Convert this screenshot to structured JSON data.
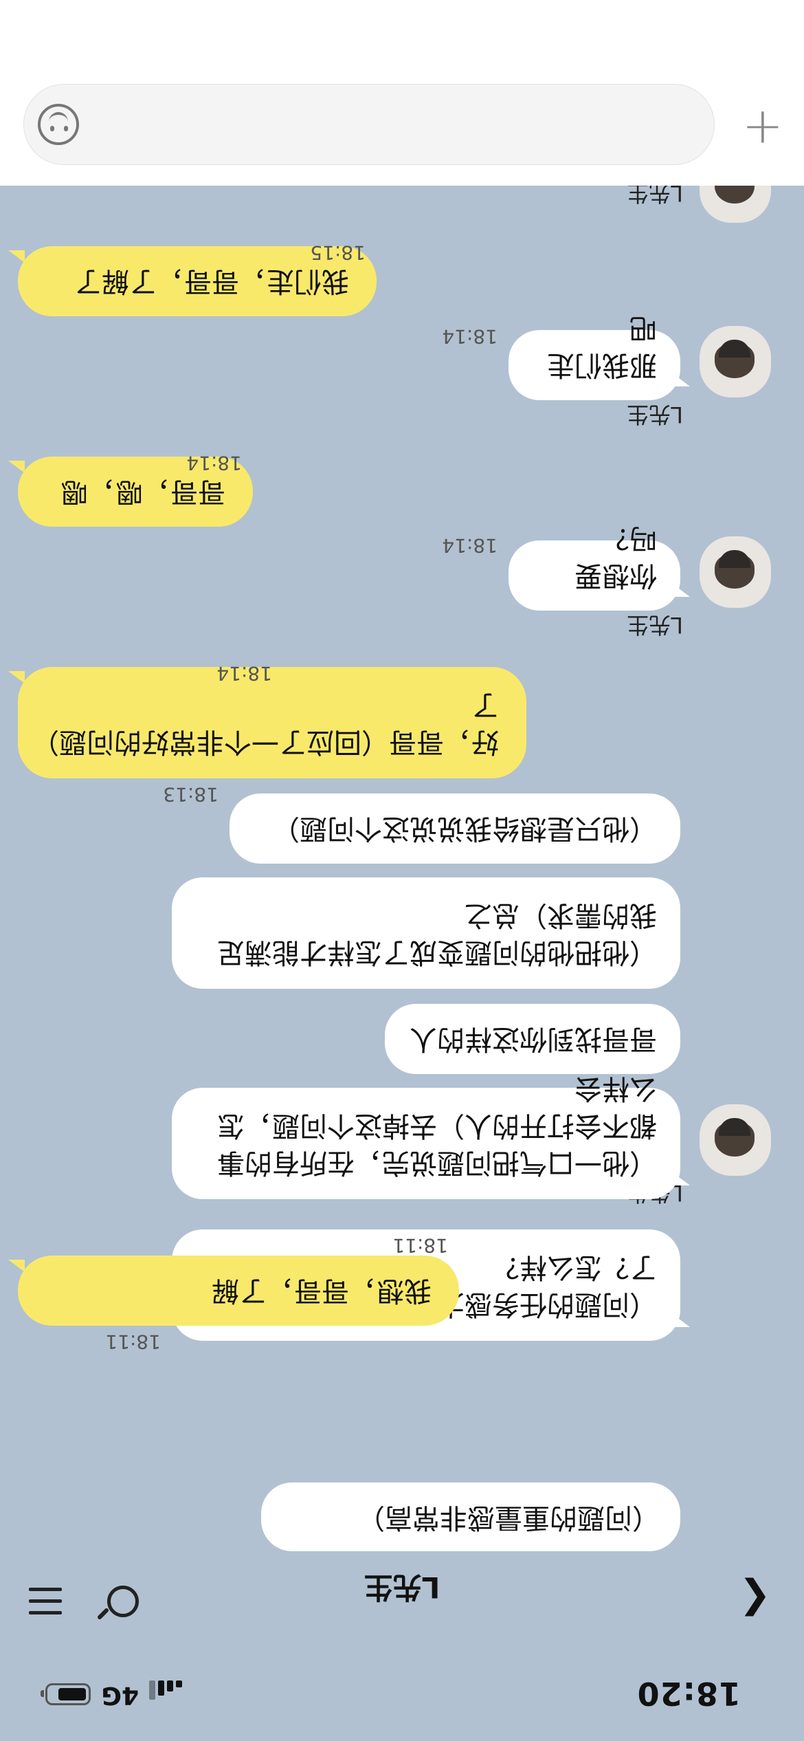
{
  "status": {
    "time": "18:20",
    "network": "4G"
  },
  "header": {
    "title": "L先生"
  },
  "input": {
    "placeholder": ""
  },
  "messages": [
    {
      "side": "in",
      "text": "（问题的重量感非常高）",
      "time": ""
    },
    {
      "side": "in",
      "text": "（问题的任务感太明显了）会不会忘了？怎么样？",
      "time": "18:11"
    },
    {
      "side": "out",
      "text": "我想，哥哥，了解",
      "time": "18:11"
    },
    {
      "side": "in",
      "sender": "L先生",
      "text": "（他一口气把问题说完，在所有的事都不会打开的人）去掉这个问题，怎么样会",
      "time": ""
    },
    {
      "side": "in",
      "text": "哥哥找到你这样的人",
      "time": ""
    },
    {
      "side": "in",
      "text": "（他把他的问题变成了怎样才能满足我的需求）总之",
      "time": ""
    },
    {
      "side": "in",
      "text": "（他只是想给我说说这个问题）",
      "time": "18:13"
    },
    {
      "side": "out",
      "text": "好，哥哥（回应了一个非常好的问题）了",
      "time": "18:14"
    },
    {
      "side": "in",
      "sender": "L先生",
      "text": "你想要吗？",
      "time": "18:14"
    },
    {
      "side": "out",
      "text": "哥哥，嗯，嗯",
      "time": "18:14"
    },
    {
      "side": "in",
      "sender": "L先生",
      "text": "那我们走吧",
      "time": "18:14"
    },
    {
      "side": "out",
      "text": "我们走，哥哥，了解了",
      "time": "18:15"
    }
  ]
}
